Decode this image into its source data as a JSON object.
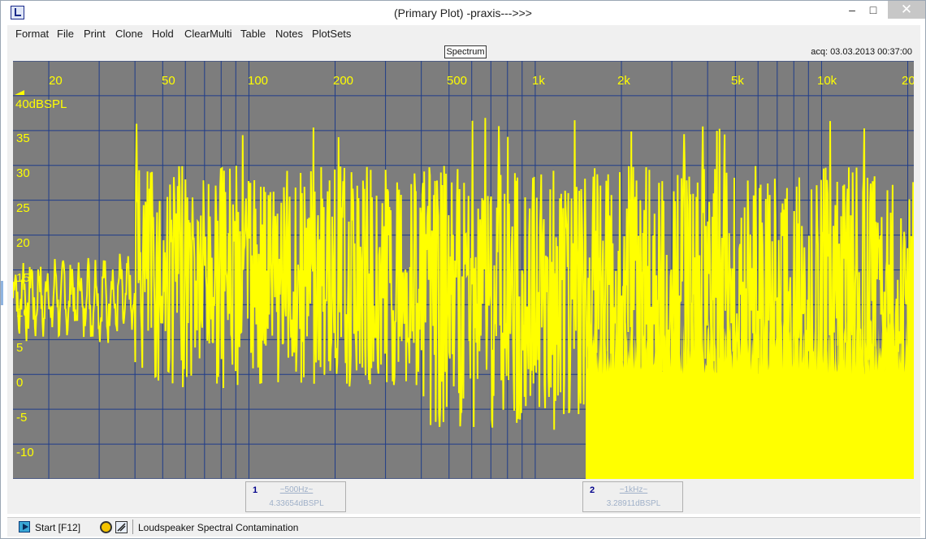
{
  "window": {
    "title": "(Primary Plot) -praxis--->>>",
    "minimize_glyph": "–",
    "maximize_glyph": "□",
    "close_glyph": "✕"
  },
  "menu": [
    "Format",
    "File",
    "Print",
    "Clone",
    "Hold",
    "ClearMulti",
    "Table",
    "Notes",
    "PlotSets"
  ],
  "plot": {
    "mode_label": "Spectrum",
    "acquired": "acq: 03.03.2013 00:37:00",
    "y_unit": "40dBSPL",
    "x_ticks": [
      "20",
      "50",
      "100",
      "200",
      "500",
      "1k",
      "2k",
      "5k",
      "10k",
      "20"
    ],
    "y_ticks": [
      "35",
      "30",
      "25",
      "20",
      "15",
      "10",
      "5",
      "0",
      "-5",
      "-10"
    ],
    "colors": {
      "background": "#7d7d7d",
      "grid": "#1f3c8a",
      "trace": "#ffff00"
    },
    "x_range_hz": [
      15,
      21000
    ],
    "y_range_db": [
      -15,
      45
    ],
    "x_scale": "log"
  },
  "cursors": [
    {
      "number": "1",
      "freq": "~500Hz~",
      "level": "4.33654dBSPL"
    },
    {
      "number": "2",
      "freq": "~1kHz~",
      "level": "3.28911dBSPL"
    }
  ],
  "status": {
    "start_label": "Start [F12]",
    "text": "Loudspeaker Spectral Contamination"
  },
  "icons": [
    "app-icon",
    "start-icon",
    "gauge-icon",
    "probe-icon"
  ]
}
